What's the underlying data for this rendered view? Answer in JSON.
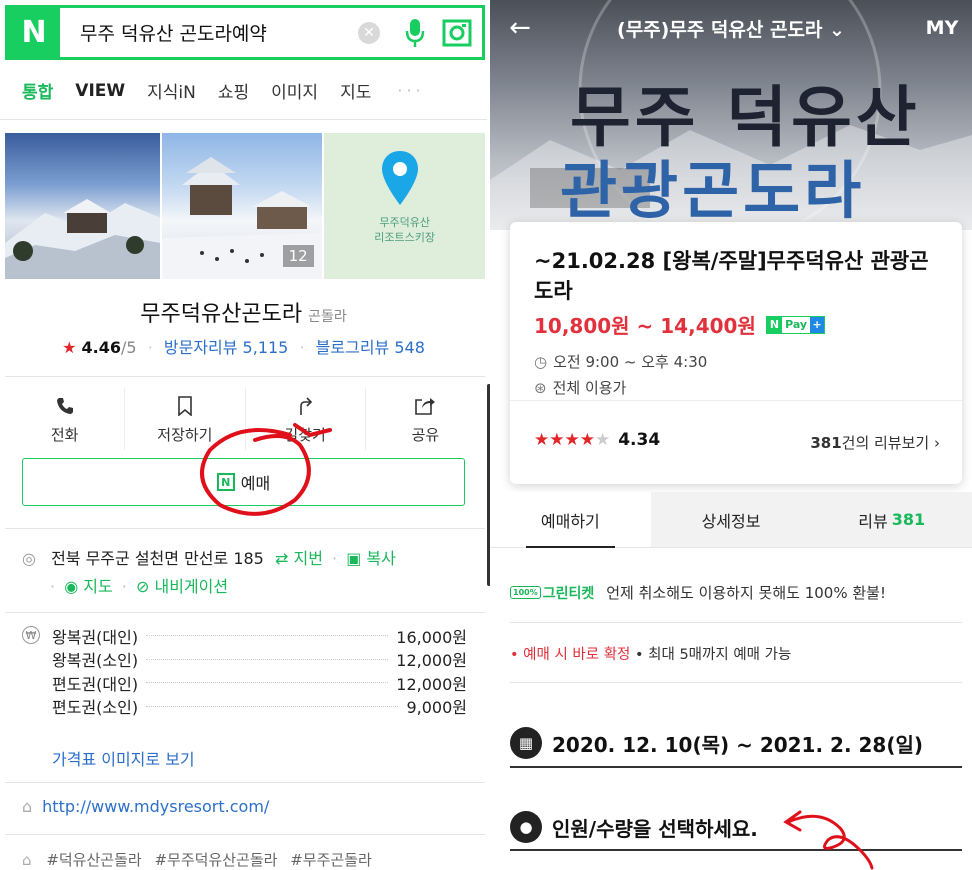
{
  "left": {
    "search": {
      "logo": "N",
      "query": "무주 덕유산 곤도라예약"
    },
    "tabs": [
      "통합",
      "VIEW",
      "지식iN",
      "쇼핑",
      "이미지",
      "지도"
    ],
    "photos": {
      "count": "12",
      "map_label_line1": "무주덕유산",
      "map_label_line2": "리조트스키장"
    },
    "place": {
      "name": "무주덕유산곤도라",
      "category": "곤돌라",
      "rating": "4.46",
      "rating_max": "/5",
      "visitor_reviews": "방문자리뷰 5,115",
      "blog_reviews": "블로그리뷰 548"
    },
    "actions": {
      "call": "전화",
      "save": "저장하기",
      "directions": "길찾기",
      "share": "공유"
    },
    "reserve_label": "예매",
    "address": {
      "text": "전북 무주군 설천면 만선로 185",
      "lot_number": "지번",
      "copy": "복사",
      "map": "지도",
      "navigation": "내비게이션"
    },
    "prices": [
      {
        "name": "왕복권(대인)",
        "value": "16,000원"
      },
      {
        "name": "왕복권(소인)",
        "value": "12,000원"
      },
      {
        "name": "편도권(대인)",
        "value": "12,000원"
      },
      {
        "name": "편도권(소인)",
        "value": "9,000원"
      }
    ],
    "price_image_link": "가격표 이미지로 보기",
    "homepage_url": "http://www.mdysresort.com/",
    "tags": [
      "#덕유산곤돌라",
      "#무주덕유산곤돌라",
      "#무주곤돌라"
    ]
  },
  "right": {
    "header": {
      "title": "(무주)무주 덕유산 곤도라",
      "my": "MY"
    },
    "hero": {
      "line1": "무주 덕유산",
      "line2": "관광곤도라"
    },
    "card": {
      "title": "~21.02.28 [왕복/주말]무주덕유산 관광곤도라",
      "price": "10,800원 ~ 14,400원",
      "npay_n": "N",
      "npay_pay": "Pay",
      "hours": "오전 9:00 ~ 오후 4:30",
      "audience": "전체 이용가",
      "rating": "4.34",
      "review_count": "381",
      "review_suffix": "건의 리뷰보기"
    },
    "tabs": {
      "reserve": "예매하기",
      "detail": "상세정보",
      "review": "리뷰",
      "review_count": "381"
    },
    "greenticket": {
      "badge_100": "100%",
      "badge": "그린티켓",
      "text": "언제 취소해도 이용하지 못해도 100% 환불!"
    },
    "confirm": {
      "red": "예매 시 바로 확정",
      "rest": "최대 5매까지 예매 가능"
    },
    "date_range": "2020. 12. 10(목) ~ 2021. 2. 28(일)",
    "people_prompt": "인원/수량을 선택하세요."
  },
  "colors": {
    "naver_green": "#19ce60",
    "link_blue": "#2c6fc9",
    "price_red": "#e0313c",
    "star_red": "#e2262a",
    "annotation_red": "#e0101a"
  }
}
